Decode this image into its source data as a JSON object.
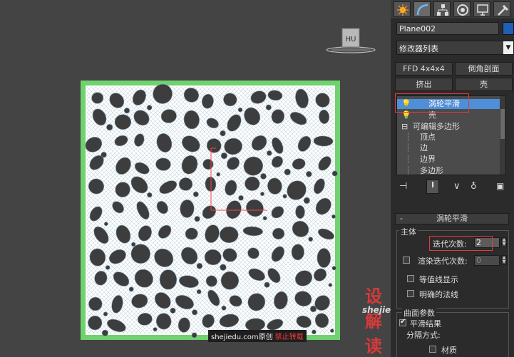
{
  "viewport": {
    "viewcube_label": "HU"
  },
  "watermark": {
    "site": "shejiedu.com",
    "original": "原创",
    "no_repost": "禁止转载",
    "logo_text": "设解读",
    "logo_url": "shejiedu.com"
  },
  "panel": {
    "tabs": [
      "create-icon",
      "modify-icon",
      "hierarchy-icon",
      "motion-icon",
      "display-icon",
      "utilities-icon"
    ],
    "object_name": "Plane002",
    "object_color": "#1f5fb5",
    "modifier_list": "修改器列表",
    "buttons": {
      "ffd": "FFD 4x4x4",
      "chamfer": "倒角剖面",
      "extrude": "挤出",
      "shell": "壳"
    },
    "stack": [
      {
        "label": "涡轮平滑",
        "indent": 0,
        "bulb": true
      },
      {
        "label": "壳",
        "indent": 0,
        "bulb": true
      },
      {
        "label": "可编辑多边形",
        "indent": 0,
        "bulb": false
      },
      {
        "label": "顶点",
        "indent": 1
      },
      {
        "label": "边",
        "indent": 1
      },
      {
        "label": "边界",
        "indent": 1
      },
      {
        "label": "多边形",
        "indent": 1
      }
    ],
    "rollout": {
      "title": "涡轮平滑",
      "collapse": "-",
      "group_main": "主体",
      "iterations_label": "迭代次数:",
      "iterations_value": "2",
      "render_iters_label": "渲染迭代次数:",
      "render_iters_value": "0",
      "isoline": "等值线显示",
      "explicit_normals": "明确的法线",
      "group_surface": "曲面参数",
      "smooth_result": "平滑结果",
      "separate_by": "分隔方式:",
      "material": "材质"
    }
  },
  "colors": {
    "accent_select": "#4f8ed8",
    "highlight_box": "#e23b3b",
    "plane_border": "#6fd26f"
  }
}
